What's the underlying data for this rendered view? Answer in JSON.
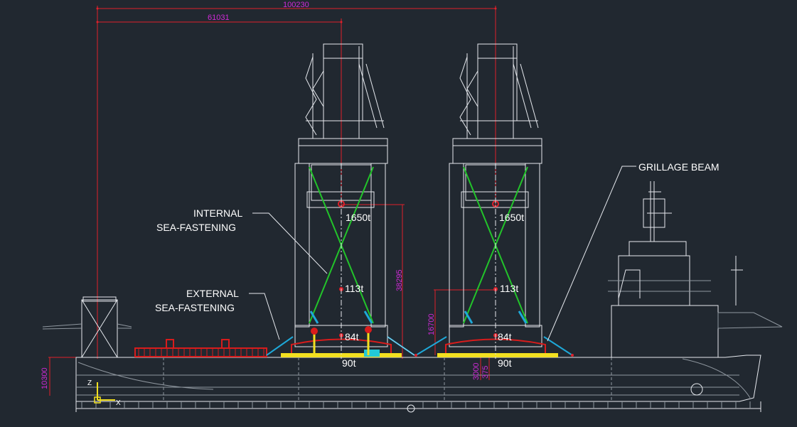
{
  "labels": {
    "internal_1": "INTERNAL",
    "internal_2": "SEA-FASTENING",
    "external_1": "EXTERNAL",
    "external_2": "SEA-FASTENING",
    "grillage": "GRILLAGE BEAM"
  },
  "dimensions": {
    "overall": "100230",
    "first_crane": "61031",
    "height_cog": "38295",
    "height_lower": "16700",
    "deck_height": "10300",
    "d3000": "3000",
    "d375": "375"
  },
  "weights": {
    "crane1_top": "1650t",
    "crane1_mid": "113t",
    "crane1_84": "84t",
    "crane1_90": "90t",
    "crane2_top": "1650t",
    "crane2_mid": "113t",
    "crane2_84": "84t",
    "crane2_90": "90t"
  },
  "axes": {
    "z": "Z",
    "x": "X"
  },
  "colors": {
    "background": "#212830",
    "dimension_line": "#e0202a",
    "dimension_text": "#d02ad8",
    "fastening": "#22c42a",
    "deck_cargo": "#d81c1c",
    "grillage": "#f2e020",
    "brace": "#1ea8d8"
  }
}
